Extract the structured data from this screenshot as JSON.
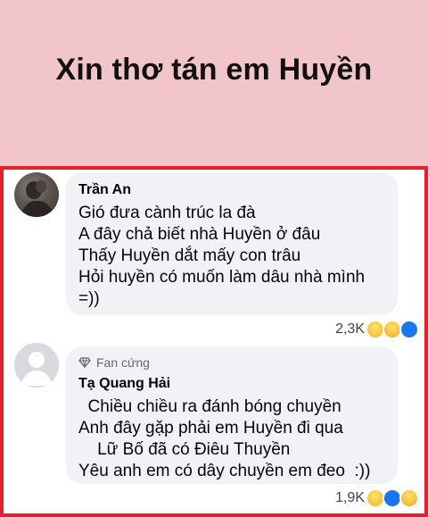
{
  "header": {
    "title": "Xin thơ tán em Huyền"
  },
  "colors": {
    "header_bg": "#f2c5cb",
    "frame_border": "#e5202a",
    "bubble_bg": "#f0f2f5"
  },
  "comments": [
    {
      "author": "Trần An",
      "lines": [
        "Gió đưa cành trúc la đà",
        "A đây chả biết nhà Huyền ở đâu",
        "Thấy Huyền dắt mấy con trâu",
        "Hỏi huyền có muốn làm dâu nhà mình",
        "=))"
      ],
      "reaction_count": "2,3K",
      "reactions": [
        "haha-icon",
        "sad-icon",
        "like-icon"
      ]
    },
    {
      "badge": "Fan cứng",
      "author": "Tạ Quang Hải",
      "lines": [
        "  Chiều chiều ra đánh bóng chuyền",
        "Anh đây gặp phải em Huyền đi qua",
        "    Lữ Bố đã có Điêu Thuyền",
        "Yêu anh em có dây chuyền em đeo  :))"
      ],
      "reaction_count": "1,9K",
      "reactions": [
        "haha-icon",
        "like-icon",
        "sad-icon"
      ]
    }
  ]
}
